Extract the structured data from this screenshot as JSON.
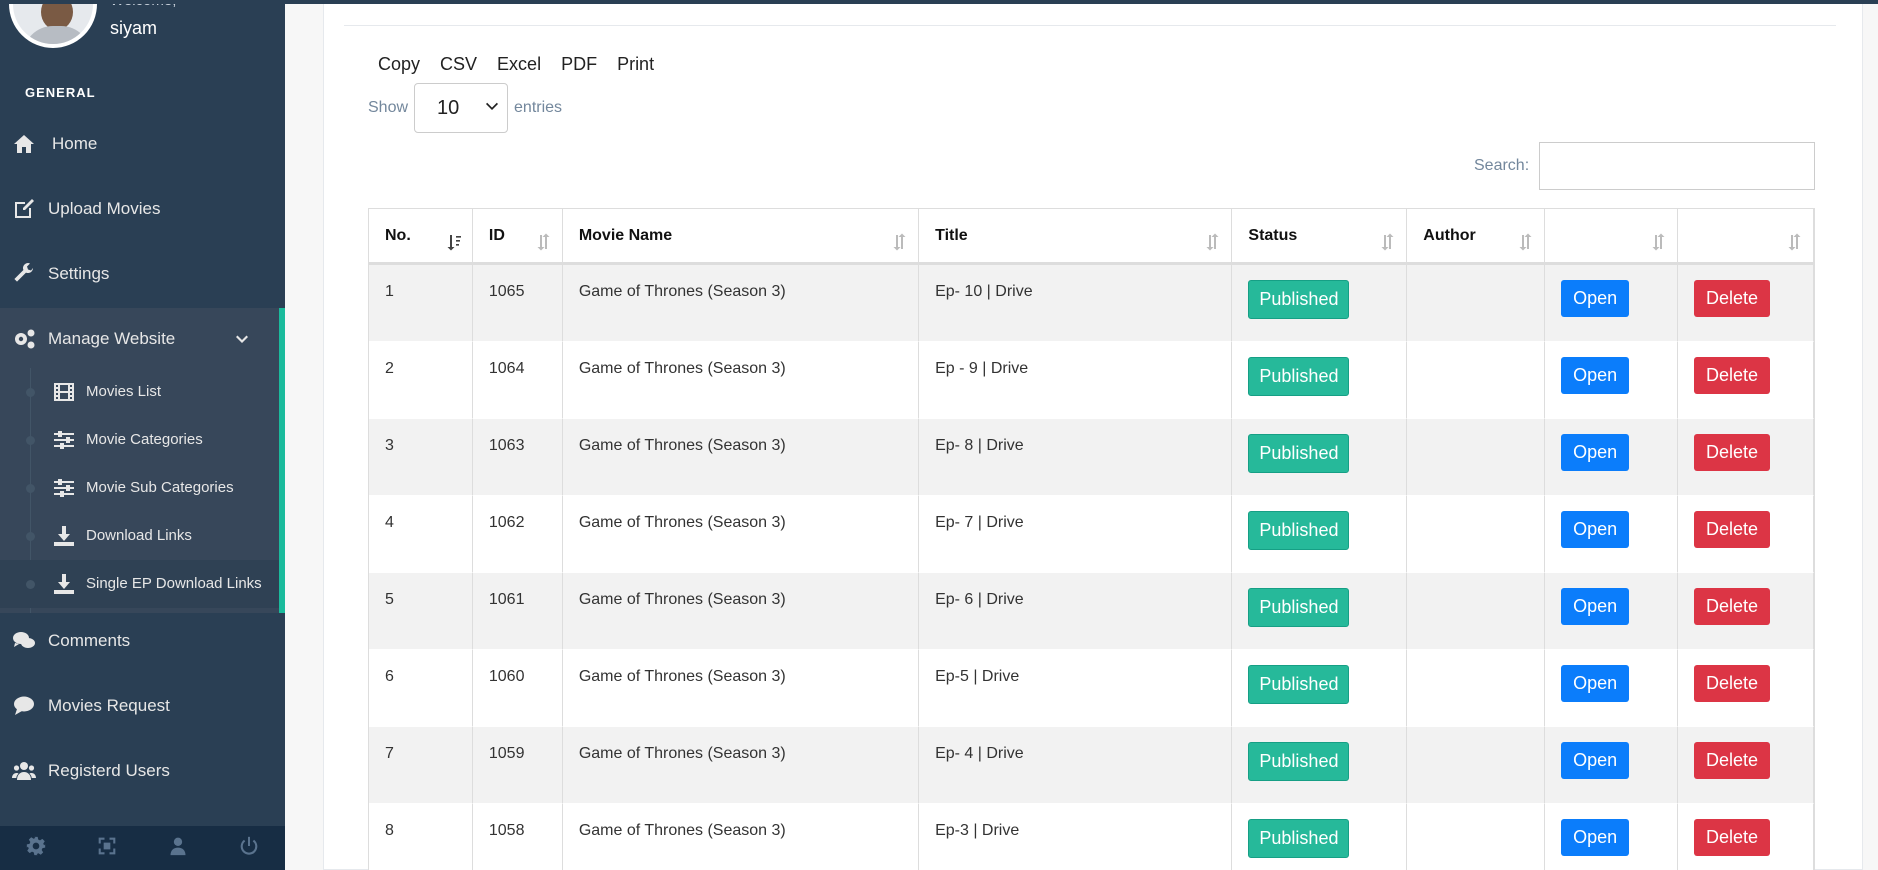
{
  "user": {
    "welcome": "Welcome,",
    "name": "siyam"
  },
  "sidebar": {
    "section": "GENERAL",
    "items": [
      {
        "label": "Home",
        "icon": "home-icon"
      },
      {
        "label": "Upload Movies",
        "icon": "edit-icon"
      },
      {
        "label": "Settings",
        "icon": "wrench-icon"
      },
      {
        "label": "Manage Website",
        "icon": "gears-icon",
        "expanded": true
      },
      {
        "label": "Comments",
        "icon": "comments-icon"
      },
      {
        "label": "Movies Request",
        "icon": "comment-icon"
      },
      {
        "label": "Registerd Users",
        "icon": "users-icon"
      }
    ],
    "submenu": [
      {
        "label": "Movies List",
        "icon": "film-icon"
      },
      {
        "label": "Movie Categories",
        "icon": "sliders-icon"
      },
      {
        "label": "Movie Sub Categories",
        "icon": "sliders-icon"
      },
      {
        "label": "Download Links",
        "icon": "download-icon"
      },
      {
        "label": "Single EP Download Links",
        "icon": "download-icon",
        "current": true
      }
    ],
    "footer": [
      "gear-icon",
      "fullscreen-icon",
      "user-icon",
      "power-icon"
    ]
  },
  "toolbar": {
    "copy": "Copy",
    "csv": "CSV",
    "excel": "Excel",
    "pdf": "PDF",
    "print": "Print"
  },
  "length": {
    "show": "Show",
    "value": "10",
    "entries": "entries"
  },
  "search": {
    "label": "Search:",
    "value": ""
  },
  "table": {
    "columns": [
      "No.",
      "ID",
      "Movie Name",
      "Title",
      "Status",
      "Author",
      "",
      ""
    ],
    "rows": [
      {
        "no": "1",
        "id": "1065",
        "movie": "Game of Thrones (Season 3)",
        "title": "Ep- 10 | Drive",
        "status": "Published",
        "author": "",
        "open": "Open",
        "delete": "Delete"
      },
      {
        "no": "2",
        "id": "1064",
        "movie": "Game of Thrones (Season 3)",
        "title": "Ep - 9 | Drive",
        "status": "Published",
        "author": "",
        "open": "Open",
        "delete": "Delete"
      },
      {
        "no": "3",
        "id": "1063",
        "movie": "Game of Thrones (Season 3)",
        "title": "Ep- 8 | Drive",
        "status": "Published",
        "author": "",
        "open": "Open",
        "delete": "Delete"
      },
      {
        "no": "4",
        "id": "1062",
        "movie": "Game of Thrones (Season 3)",
        "title": "Ep- 7 | Drive",
        "status": "Published",
        "author": "",
        "open": "Open",
        "delete": "Delete"
      },
      {
        "no": "5",
        "id": "1061",
        "movie": "Game of Thrones (Season 3)",
        "title": "Ep- 6 | Drive",
        "status": "Published",
        "author": "",
        "open": "Open",
        "delete": "Delete"
      },
      {
        "no": "6",
        "id": "1060",
        "movie": "Game of Thrones (Season 3)",
        "title": "Ep-5 | Drive",
        "status": "Published",
        "author": "",
        "open": "Open",
        "delete": "Delete"
      },
      {
        "no": "7",
        "id": "1059",
        "movie": "Game of Thrones (Season 3)",
        "title": "Ep- 4 | Drive",
        "status": "Published",
        "author": "",
        "open": "Open",
        "delete": "Delete"
      },
      {
        "no": "8",
        "id": "1058",
        "movie": "Game of Thrones (Season 3)",
        "title": "Ep-3 | Drive",
        "status": "Published",
        "author": "",
        "open": "Open",
        "delete": "Delete"
      }
    ]
  },
  "colors": {
    "sidebar": "#2a3f54",
    "accent": "#1abb9c",
    "published": "#26b99a",
    "open": "#0b7dfb",
    "delete": "#dc3545"
  }
}
